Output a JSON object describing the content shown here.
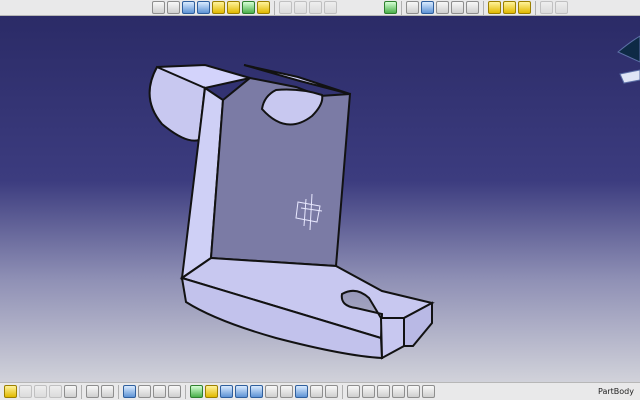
{
  "statusbar": {
    "part_body_label": "PartBody"
  },
  "colors": {
    "bg_top": "#2b2b67",
    "bg_bottom": "#d1d2da",
    "part_face": "#c8c8f0",
    "part_shadow": "#7b7ba5",
    "part_edge": "#121212"
  },
  "icons": {
    "toolbar_top": [
      "select-arrow-icon",
      "sketch-icon",
      "pad-icon",
      "pocket-icon",
      "shaft-icon",
      "groove-icon",
      "fillet-icon",
      "chamfer-icon",
      "pattern-icon",
      "mirror-icon",
      "measure-icon",
      "view-icon",
      "axis-icon",
      "compass-icon",
      "render-icon"
    ],
    "toolbar_bottom": [
      "save-icon",
      "print-icon",
      "undo-icon",
      "formula-icon",
      "comment-icon",
      "grid-icon",
      "snap-icon",
      "pan-icon",
      "rotate-icon",
      "zoom-in-icon",
      "zoom-out-icon",
      "fit-all-icon",
      "normal-view-icon",
      "iso-view-icon",
      "shading-icon",
      "hide-icon",
      "swap-icon",
      "info-icon",
      "update-icon"
    ]
  }
}
